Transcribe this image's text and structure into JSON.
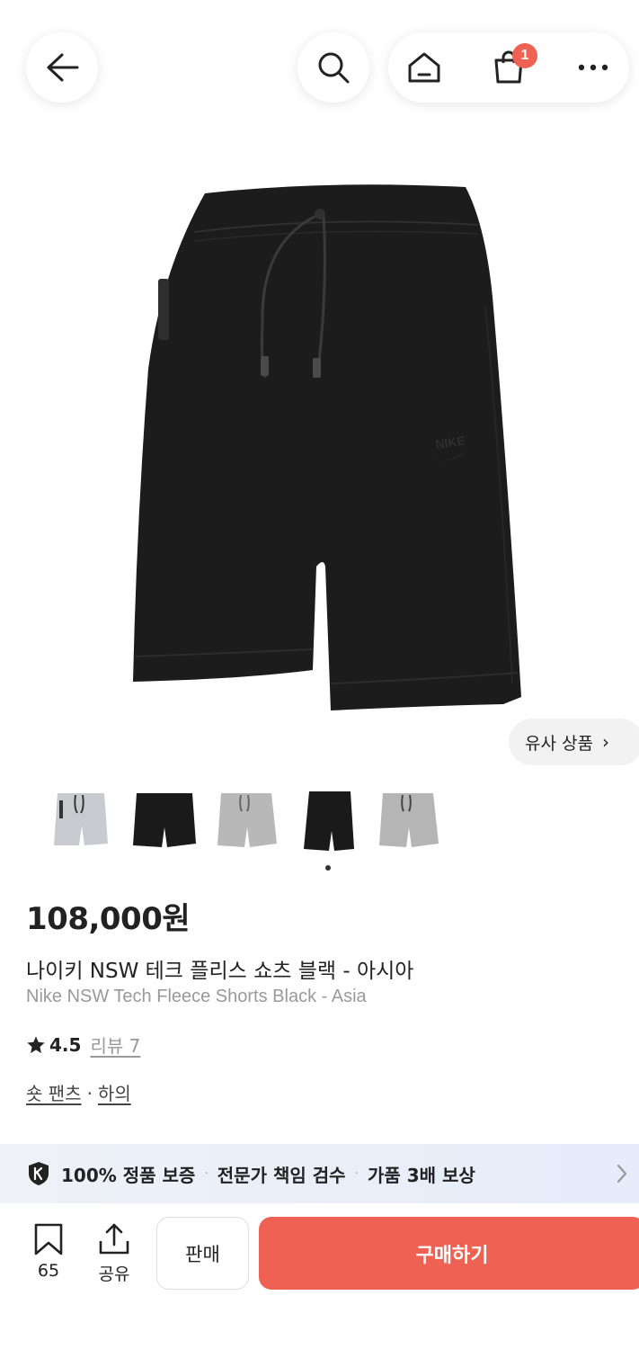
{
  "header": {
    "cart_count": "1"
  },
  "product": {
    "similar_label": "유사 상품",
    "similar_chevron": "›",
    "price": "108,000원",
    "name_ko": "나이키 NSW 테크 플리스 쇼츠 블랙 - 아시아",
    "name_en": "Nike NSW Tech Fleece Shorts Black - Asia",
    "rating": "4.5",
    "reviews_label": "리뷰 7",
    "categories": [
      "숏 팬츠",
      "하의"
    ],
    "category_sep": "·"
  },
  "thumbnails": [
    {
      "color": "light-gray",
      "hex": "#c7cbd0"
    },
    {
      "color": "black",
      "hex": "#1a1a1a"
    },
    {
      "color": "gray",
      "hex": "#b8b8b8"
    },
    {
      "color": "black",
      "hex": "#1a1a1a"
    },
    {
      "color": "gray",
      "hex": "#b5b5b5"
    }
  ],
  "guarantee": {
    "items": [
      "100% 정품 보증",
      "전문가 책임 검수",
      "가품 3배 보상"
    ],
    "bullet": "·"
  },
  "bottom_bar": {
    "bookmark_count": "65",
    "share_label": "공유",
    "sell_label": "판매",
    "buy_label": "구매하기"
  },
  "colors": {
    "accent": "#ef6253",
    "product": "#1c1c1c"
  },
  "icons": [
    "back-arrow-icon",
    "search-icon",
    "home-icon",
    "shopping-bag-icon",
    "more-icon",
    "star-icon",
    "shield-icon",
    "chevron-right-icon",
    "bookmark-icon",
    "share-icon"
  ]
}
